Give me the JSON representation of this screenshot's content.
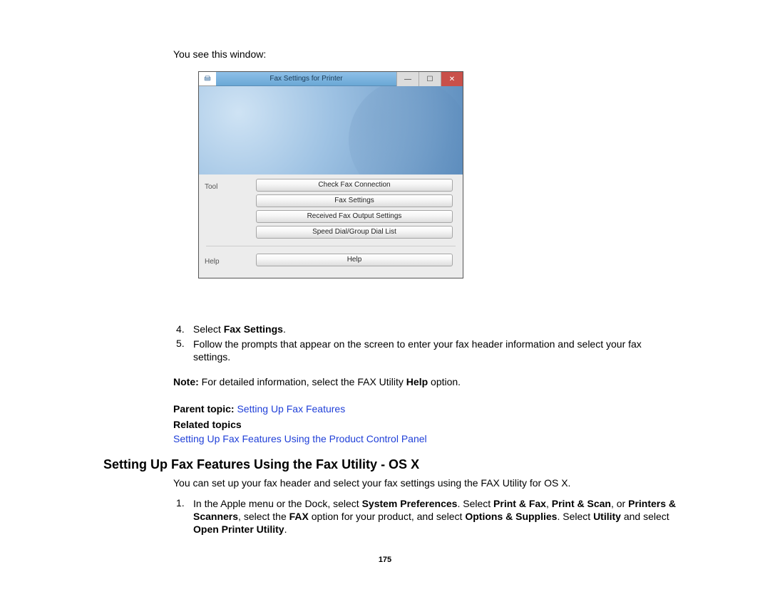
{
  "intro": "You see this window:",
  "window": {
    "title": "Fax Settings for Printer",
    "tool_label": "Tool",
    "help_label": "Help",
    "buttons": {
      "check": "Check Fax Connection",
      "settings": "Fax Settings",
      "received": "Received Fax Output Settings",
      "speed": "Speed Dial/Group Dial List",
      "help": "Help"
    },
    "controls": {
      "min": "—",
      "max": "☐",
      "close": "✕"
    }
  },
  "step4": {
    "num": "4.",
    "pre": "Select ",
    "bold": "Fax Settings",
    "post": "."
  },
  "step5": {
    "num": "5.",
    "text": "Follow the prompts that appear on the screen to enter your fax header information and select your fax settings."
  },
  "note": {
    "label": "Note:",
    "pre": " For detailed information, select the FAX Utility ",
    "bold": "Help",
    "post": " option."
  },
  "parent": {
    "label": "Parent topic: ",
    "link": "Setting Up Fax Features"
  },
  "related": {
    "label": "Related topics",
    "link": "Setting Up Fax Features Using the Product Control Panel"
  },
  "heading": "Setting Up Fax Features Using the Fax Utility - OS X",
  "desc": "You can set up your fax header and select your fax settings using the FAX Utility for OS X.",
  "instr1": {
    "num": "1.",
    "t1": "In the Apple menu or the Dock, select ",
    "b1": "System Preferences",
    "t2": ". Select ",
    "b2": "Print & Fax",
    "t3": ", ",
    "b3": "Print & Scan",
    "t4": ", or ",
    "b4": "Printers & Scanners",
    "t5": ", select the ",
    "b5": "FAX",
    "t6": " option for your product, and select ",
    "b6": "Options & Supplies",
    "t7": ". Select ",
    "b7": "Utility",
    "t8": " and select ",
    "b8": "Open Printer Utility",
    "t9": "."
  },
  "page_number": "175"
}
